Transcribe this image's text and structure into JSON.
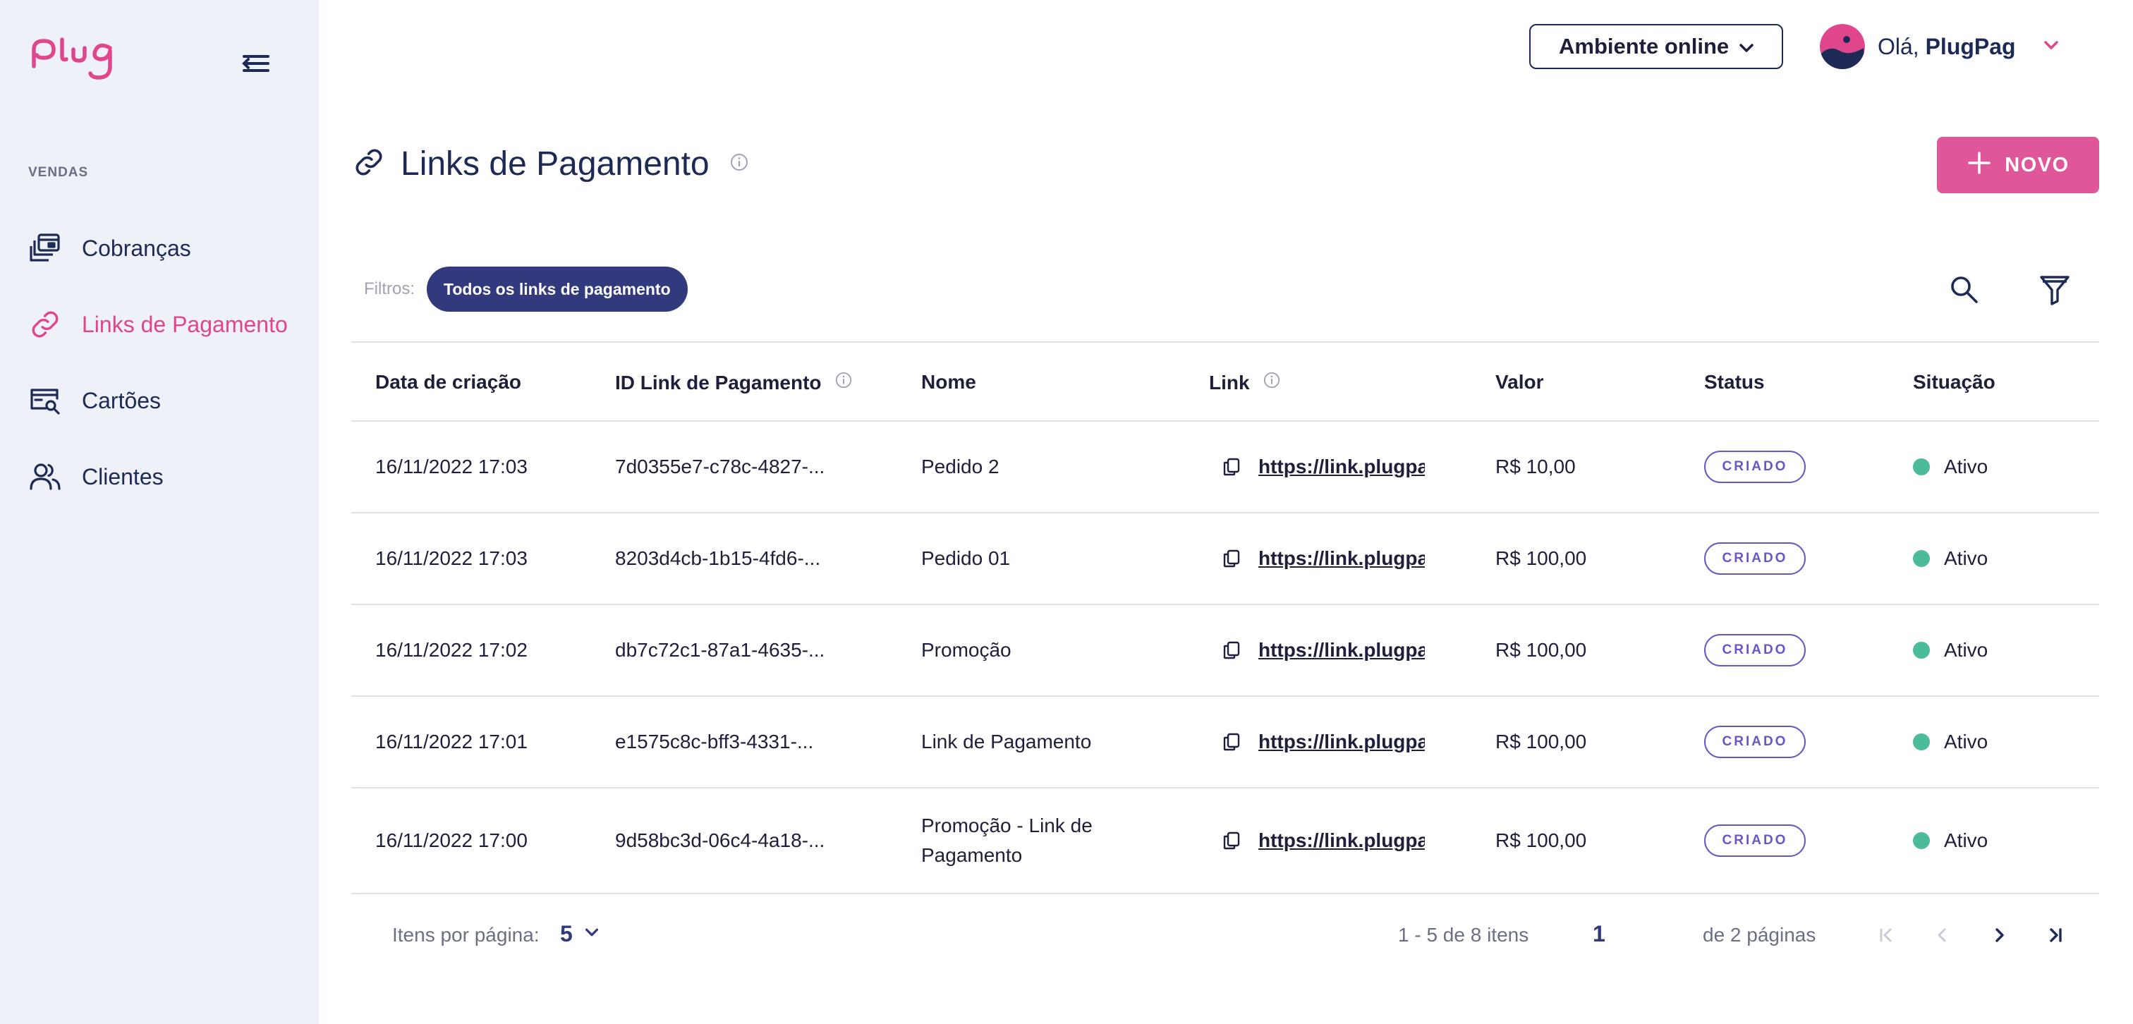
{
  "colors": {
    "accent_pink": "#e0468b",
    "navy": "#1e2a56",
    "chip_bg": "#313a7c",
    "status_purple": "#6a54c7",
    "active_green": "#4cbb9b",
    "sidebar_bg": "#eef1f7"
  },
  "sidebar": {
    "logo_icon": "plug-logo",
    "menu_icon": "menu-collapse-icon",
    "section_label": "VENDAS",
    "items": [
      {
        "label": "Cobranças",
        "icon": "charges-icon"
      },
      {
        "label": "Links de Pagamento",
        "icon": "link-icon",
        "active": true
      },
      {
        "label": "Cartões",
        "icon": "card-search-icon"
      },
      {
        "label": "Clientes",
        "icon": "users-icon"
      }
    ]
  },
  "header": {
    "environment": "Ambiente online",
    "greeting_prefix": "Olá,",
    "user_name": "PlugPag"
  },
  "page": {
    "title": "Links de Pagamento",
    "new_button": "NOVO"
  },
  "filters": {
    "label": "Filtros:",
    "chip": "Todos os links de pagamento"
  },
  "table": {
    "columns": [
      "Data de criação",
      "ID Link de Pagamento",
      "Nome",
      "Link",
      "Valor",
      "Status",
      "Situação"
    ],
    "rows": [
      {
        "date": "16/11/2022 17:03",
        "id": "7d0355e7-c78c-4827-...",
        "name": "Pedido 2",
        "link": "https://link.plugpag",
        "value": "R$ 10,00",
        "status": "CRIADO",
        "situation": "Ativo"
      },
      {
        "date": "16/11/2022 17:03",
        "id": "8203d4cb-1b15-4fd6-...",
        "name": "Pedido 01",
        "link": "https://link.plugpag",
        "value": "R$ 100,00",
        "status": "CRIADO",
        "situation": "Ativo"
      },
      {
        "date": "16/11/2022 17:02",
        "id": "db7c72c1-87a1-4635-...",
        "name": "Promoção",
        "link": "https://link.plugpag",
        "value": "R$ 100,00",
        "status": "CRIADO",
        "situation": "Ativo"
      },
      {
        "date": "16/11/2022 17:01",
        "id": "e1575c8c-bff3-4331-...",
        "name": "Link de Pagamento",
        "link": "https://link.plugpag",
        "value": "R$ 100,00",
        "status": "CRIADO",
        "situation": "Ativo"
      },
      {
        "date": "16/11/2022 17:00",
        "id": "9d58bc3d-06c4-4a18-...",
        "name": "Promoção - Link de Pagamento",
        "link": "https://link.plugpag",
        "value": "R$ 100,00",
        "status": "CRIADO",
        "situation": "Ativo"
      }
    ]
  },
  "pagination": {
    "per_page_label": "Itens por página:",
    "per_page_value": "5",
    "range_text": "1 - 5 de 8 itens",
    "current_page": "1",
    "total_pages_text": "de 2 páginas"
  }
}
